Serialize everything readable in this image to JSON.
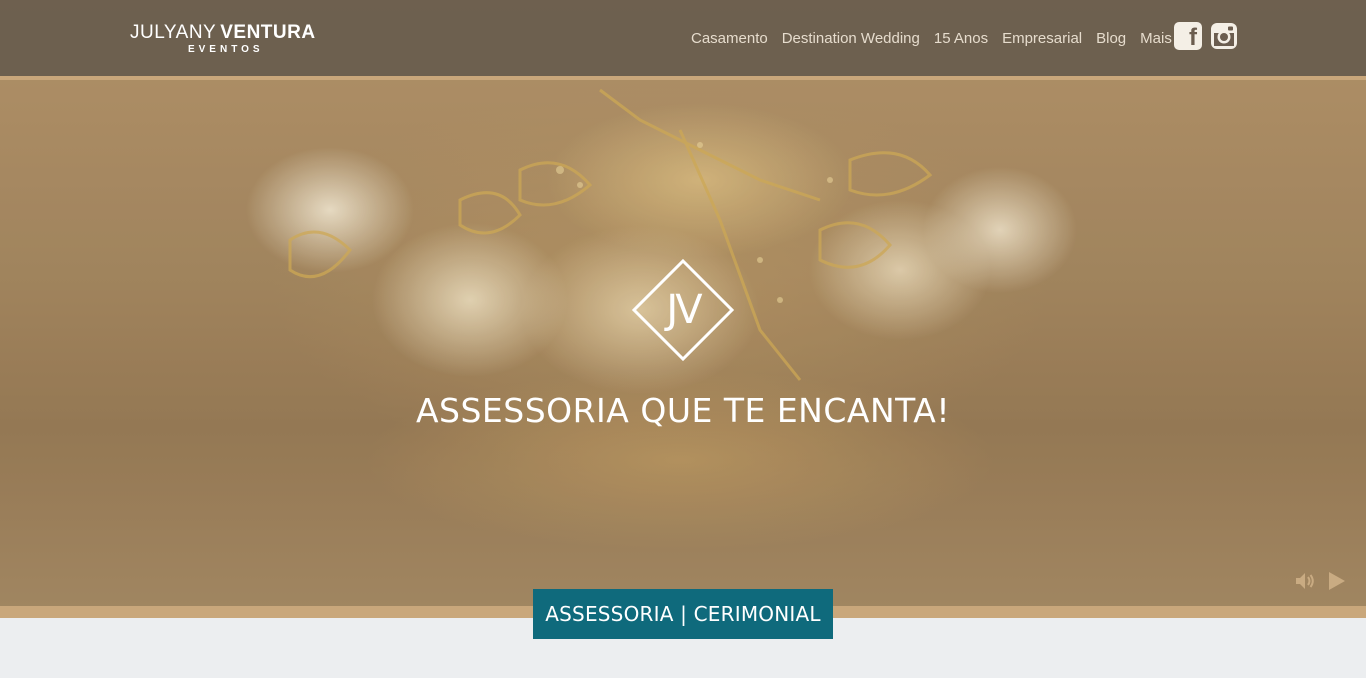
{
  "brand": {
    "name_first": "JULYANY",
    "name_second": "VENTURA",
    "sub": "EVENTOS"
  },
  "nav": {
    "items": [
      {
        "label": "Casamento"
      },
      {
        "label": "Destination Wedding"
      },
      {
        "label": "15 Anos"
      },
      {
        "label": "Empresarial"
      },
      {
        "label": "Blog"
      },
      {
        "label": "Mais"
      }
    ],
    "social": [
      {
        "icon": "facebook-icon"
      },
      {
        "icon": "instagram-icon"
      }
    ]
  },
  "hero": {
    "emblem_letters": "JV",
    "tagline": "ASSESSORIA QUE TE ENCANTA!",
    "cta_label": "ASSESSORIA | CERIMONIAL",
    "controls": [
      {
        "icon": "volume-icon"
      },
      {
        "icon": "play-icon"
      }
    ]
  },
  "colors": {
    "header_bg": "#685c4e",
    "accent_line": "#c9a77b",
    "cta_bg": "#0f6a7c",
    "nav_text": "#e6dccd"
  }
}
